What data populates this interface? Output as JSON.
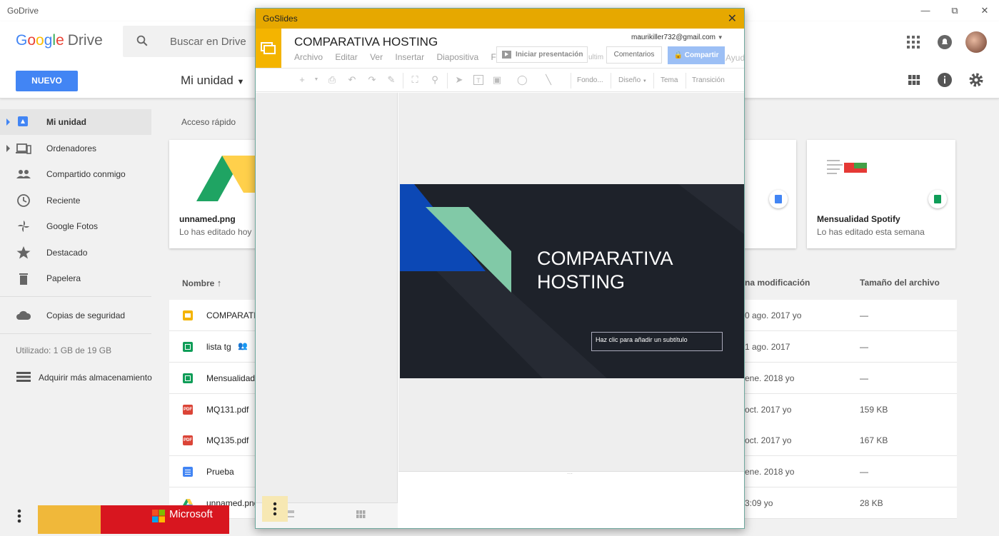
{
  "window": {
    "title": "GoDrive"
  },
  "header": {
    "logo_google": "Google",
    "logo_drive": "Drive",
    "search_placeholder": "Buscar en Drive",
    "new_label": "NUEVO",
    "location_label": "Mi unidad"
  },
  "sidebar": {
    "items": [
      {
        "label": "Mi unidad"
      },
      {
        "label": "Ordenadores"
      },
      {
        "label": "Compartido conmigo"
      },
      {
        "label": "Reciente"
      },
      {
        "label": "Google Fotos"
      },
      {
        "label": "Destacado"
      },
      {
        "label": "Papelera"
      },
      {
        "label": "Copias de seguridad"
      }
    ],
    "storage": "Utilizado: 1 GB de 19 GB",
    "buy_storage": "Adquirir más almacenamiento"
  },
  "quick_access": {
    "title": "Acceso rápido",
    "cards": [
      {
        "name": "unnamed.png",
        "sub": "Lo has editado hoy"
      },
      {
        "name": "Mensualidad Spotify",
        "sub": "Lo has editado esta semana"
      }
    ]
  },
  "list": {
    "col_name": "Nombre",
    "col_modified": "na modificación",
    "col_size": "Tamaño del archivo",
    "rows": [
      {
        "name": "COMPARATI",
        "date": "0 ago. 2017  yo",
        "size": "—",
        "type": "slides"
      },
      {
        "name": "lista tg",
        "date": "1 ago. 2017",
        "size": "—",
        "type": "sheets"
      },
      {
        "name": "Mensualidad",
        "date": "ene. 2018  yo",
        "size": "—",
        "type": "sheets"
      },
      {
        "name": "MQ131.pdf",
        "date": "oct. 2017  yo",
        "size": "159 KB",
        "type": "pdf"
      },
      {
        "name": "MQ135.pdf",
        "date": "oct. 2017  yo",
        "size": "167 KB",
        "type": "pdf"
      },
      {
        "name": "Prueba",
        "date": "ene. 2018  yo",
        "size": "—",
        "type": "docs"
      },
      {
        "name": "unnamed.png",
        "date": "3:09  yo",
        "size": "28 KB",
        "type": "image"
      }
    ]
  },
  "ad": {
    "brand": "Microsoft"
  },
  "slides": {
    "window_title": "GoSlides",
    "doc_title": "COMPARATIVA HOSTING",
    "account": "maurikiller732@gmail.com",
    "menu": [
      "Archivo",
      "Editar",
      "Ver",
      "Insertar",
      "Diapositiva",
      "Forr"
    ],
    "menu_hidden": "ultim",
    "menu_help": "Ayud",
    "present_label": "Iniciar presentación",
    "comments_label": "Comentarios",
    "share_label": "Compartir",
    "toolbar": {
      "fondo": "Fondo...",
      "diseno": "Diseño",
      "tema": "Tema",
      "transicion": "Transición"
    },
    "slide_title_line1": "COMPARATIVA",
    "slide_title_line2": "HOSTING",
    "slide_subtitle": "Haz clic para añadir un subtítulo"
  },
  "colors": {
    "accent": "#4285f4",
    "slides_bar": "#e6a800",
    "slide_bg": "#1e222a"
  }
}
